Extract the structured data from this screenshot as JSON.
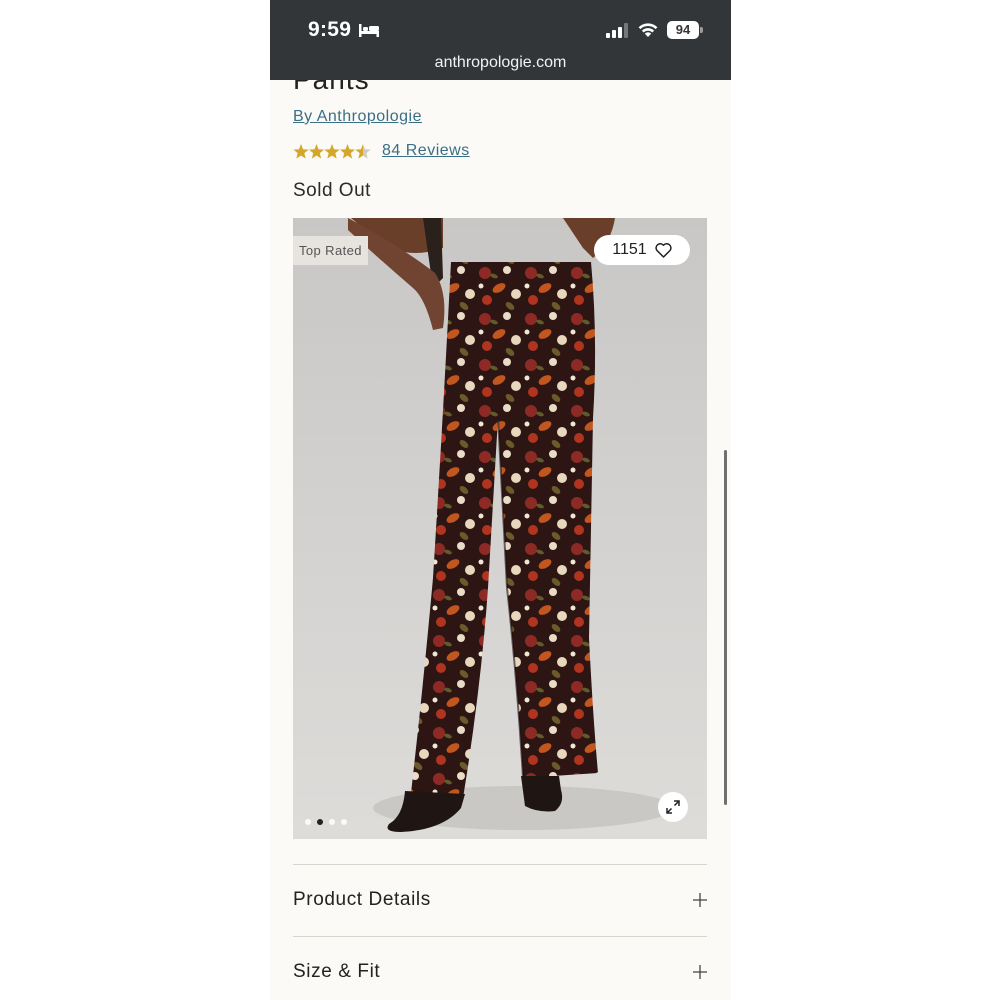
{
  "status_bar": {
    "time": "9:59",
    "battery": "94",
    "icons": [
      "bed-icon",
      "signal-icon",
      "wifi-icon",
      "battery-icon"
    ]
  },
  "browser": {
    "url": "anthropologie.com"
  },
  "product": {
    "title_partial": "Pants",
    "brand_link": "By Anthropologie",
    "rating": 4.5,
    "reviews_link": "84 Reviews",
    "stock_status": "Sold Out",
    "image": {
      "badge": "Top Rated",
      "favorites_count": "1151",
      "carousel_count": 4,
      "carousel_active_index": 1
    }
  },
  "accordions": [
    {
      "label": "Product Details"
    },
    {
      "label": "Size & Fit"
    }
  ],
  "colors": {
    "top_bar": "#323638",
    "link": "#3a6f86",
    "star": "#d4a72c",
    "background": "#fbfaf6"
  }
}
